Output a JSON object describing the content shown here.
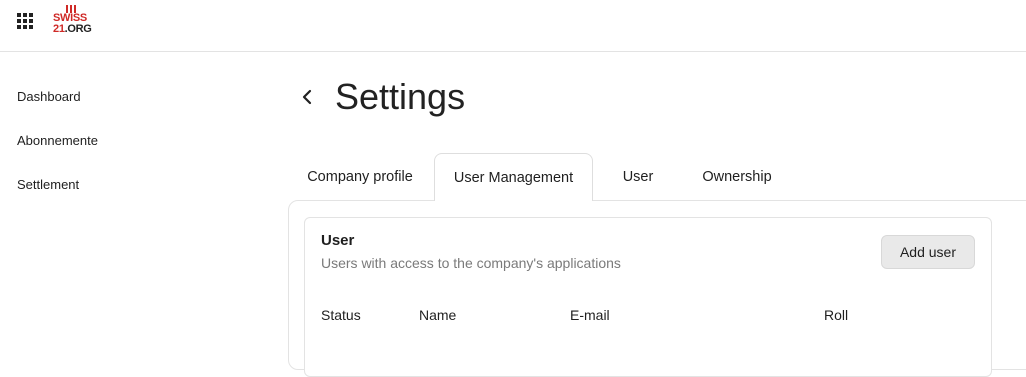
{
  "header": {
    "logo": {
      "line1": "SWISS",
      "line2_part1": "21",
      "line2_part2": ".ORG"
    }
  },
  "sidebar": {
    "items": [
      {
        "label": "Dashboard"
      },
      {
        "label": "Abonnemente"
      },
      {
        "label": "Settlement"
      }
    ]
  },
  "page": {
    "title": "Settings"
  },
  "tabs": [
    {
      "label": "Company profile",
      "active": false
    },
    {
      "label": "User Management",
      "active": true
    },
    {
      "label": "User",
      "active": false
    },
    {
      "label": "Ownership",
      "active": false
    }
  ],
  "user_card": {
    "title": "User",
    "subtitle": "Users with access to the company's applications",
    "add_button": "Add user",
    "columns": [
      "Status",
      "Name",
      "E-mail",
      "Roll"
    ]
  },
  "colors": {
    "brand_red": "#cf2a27",
    "button_bg": "#e9e9e9",
    "border": "#e3e3e3"
  }
}
